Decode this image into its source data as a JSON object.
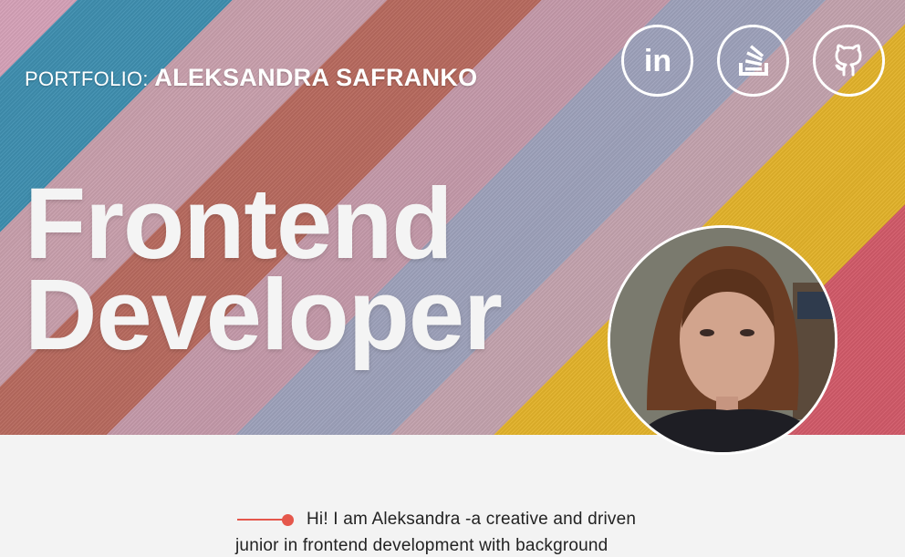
{
  "header": {
    "prefix": "PORTFOLIO:",
    "name": "ALEKSANDRA SAFRANKO"
  },
  "socials": [
    {
      "icon": "linkedin-icon",
      "label": "in"
    },
    {
      "icon": "stackoverflow-icon"
    },
    {
      "icon": "github-icon"
    }
  ],
  "hero": {
    "line1": "Frontend",
    "line2": "Developer"
  },
  "intro": {
    "text": "Hi! I am Aleksandra -a creative and driven junior in frontend development with background"
  },
  "colors": {
    "accent": "#e5574b",
    "headline": "#f4f4f4",
    "background": "#f3f3f3"
  }
}
